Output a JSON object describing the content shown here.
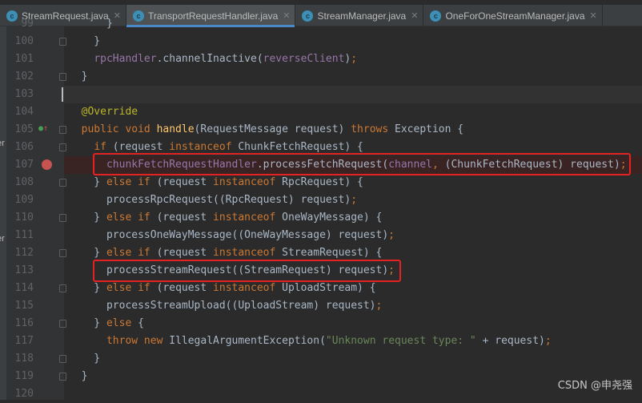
{
  "tabs": [
    {
      "label": "StreamRequest.java",
      "active": false
    },
    {
      "label": "TransportRequestHandler.java",
      "active": true
    },
    {
      "label": "StreamManager.java",
      "active": false
    },
    {
      "label": "OneForOneStreamManager.java",
      "active": false
    }
  ],
  "tab_icon_letter": "c",
  "left_panel_fragments": [
    "er",
    "er"
  ],
  "lines": [
    {
      "n": "99",
      "tokens": [
        {
          "t": "      }",
          "c": "p"
        }
      ]
    },
    {
      "n": "100",
      "tokens": [
        {
          "t": "    }",
          "c": "p"
        }
      ]
    },
    {
      "n": "101",
      "tokens": [
        {
          "t": "    ",
          "c": "p"
        },
        {
          "t": "rpcHandler",
          "c": "f"
        },
        {
          "t": ".channelInactive(",
          "c": "p"
        },
        {
          "t": "reverseClient",
          "c": "f"
        },
        {
          "t": ")",
          "c": "p"
        },
        {
          "t": ";",
          "c": "k"
        }
      ]
    },
    {
      "n": "102",
      "tokens": [
        {
          "t": "  }",
          "c": "p"
        }
      ]
    },
    {
      "n": "103",
      "tokens": []
    },
    {
      "n": "104",
      "tokens": [
        {
          "t": "  ",
          "c": "p"
        },
        {
          "t": "@Override",
          "c": "a"
        }
      ]
    },
    {
      "n": "105",
      "tokens": [
        {
          "t": "  ",
          "c": "p"
        },
        {
          "t": "public void ",
          "c": "k"
        },
        {
          "t": "handle",
          "c": "m"
        },
        {
          "t": "(RequestMessage request) ",
          "c": "p"
        },
        {
          "t": "throws ",
          "c": "k"
        },
        {
          "t": "Exception {",
          "c": "p"
        }
      ]
    },
    {
      "n": "106",
      "tokens": [
        {
          "t": "    ",
          "c": "p"
        },
        {
          "t": "if ",
          "c": "k"
        },
        {
          "t": "(request ",
          "c": "p"
        },
        {
          "t": "instanceof ",
          "c": "k"
        },
        {
          "t": "ChunkFetchRequest) {",
          "c": "p"
        }
      ]
    },
    {
      "n": "107",
      "tokens": [
        {
          "t": "      ",
          "c": "p"
        },
        {
          "t": "chunkFetchRequestHandler",
          "c": "f"
        },
        {
          "t": ".processFetchRequest(",
          "c": "p"
        },
        {
          "t": "channel",
          "c": "f"
        },
        {
          "t": ", ",
          "c": "k"
        },
        {
          "t": "(ChunkFetchRequest) request)",
          "c": "p"
        },
        {
          "t": ";",
          "c": "k"
        }
      ]
    },
    {
      "n": "108",
      "tokens": [
        {
          "t": "    } ",
          "c": "p"
        },
        {
          "t": "else if ",
          "c": "k"
        },
        {
          "t": "(request ",
          "c": "p"
        },
        {
          "t": "instanceof ",
          "c": "k"
        },
        {
          "t": "RpcRequest) {",
          "c": "p"
        }
      ]
    },
    {
      "n": "109",
      "tokens": [
        {
          "t": "      processRpcRequest((RpcRequest) request)",
          "c": "p"
        },
        {
          "t": ";",
          "c": "k"
        }
      ]
    },
    {
      "n": "110",
      "tokens": [
        {
          "t": "    } ",
          "c": "p"
        },
        {
          "t": "else if ",
          "c": "k"
        },
        {
          "t": "(request ",
          "c": "p"
        },
        {
          "t": "instanceof ",
          "c": "k"
        },
        {
          "t": "OneWayMessage) {",
          "c": "p"
        }
      ]
    },
    {
      "n": "111",
      "tokens": [
        {
          "t": "      processOneWayMessage((OneWayMessage) request)",
          "c": "p"
        },
        {
          "t": ";",
          "c": "k"
        }
      ]
    },
    {
      "n": "112",
      "tokens": [
        {
          "t": "    } ",
          "c": "p"
        },
        {
          "t": "else if ",
          "c": "k"
        },
        {
          "t": "(request ",
          "c": "p"
        },
        {
          "t": "instanceof ",
          "c": "k"
        },
        {
          "t": "StreamRequest) {",
          "c": "p"
        }
      ]
    },
    {
      "n": "113",
      "tokens": [
        {
          "t": "      processStreamRequest((StreamRequest) request)",
          "c": "p"
        },
        {
          "t": ";",
          "c": "k"
        }
      ]
    },
    {
      "n": "114",
      "tokens": [
        {
          "t": "    } ",
          "c": "p"
        },
        {
          "t": "else if ",
          "c": "k"
        },
        {
          "t": "(request ",
          "c": "p"
        },
        {
          "t": "instanceof ",
          "c": "k"
        },
        {
          "t": "UploadStream) {",
          "c": "p"
        }
      ]
    },
    {
      "n": "115",
      "tokens": [
        {
          "t": "      processStreamUpload((UploadStream) request)",
          "c": "p"
        },
        {
          "t": ";",
          "c": "k"
        }
      ]
    },
    {
      "n": "116",
      "tokens": [
        {
          "t": "    } ",
          "c": "p"
        },
        {
          "t": "else ",
          "c": "k"
        },
        {
          "t": "{",
          "c": "p"
        }
      ]
    },
    {
      "n": "117",
      "tokens": [
        {
          "t": "      ",
          "c": "p"
        },
        {
          "t": "throw new ",
          "c": "k"
        },
        {
          "t": "IllegalArgumentException(",
          "c": "p"
        },
        {
          "t": "\"Unknown request type: \"",
          "c": "s"
        },
        {
          "t": " + request)",
          "c": "p"
        },
        {
          "t": ";",
          "c": "k"
        }
      ]
    },
    {
      "n": "118",
      "tokens": [
        {
          "t": "    }",
          "c": "p"
        }
      ]
    },
    {
      "n": "119",
      "tokens": [
        {
          "t": "  }",
          "c": "p"
        }
      ]
    },
    {
      "n": "120",
      "tokens": []
    }
  ],
  "watermark": "CSDN @申尧强"
}
